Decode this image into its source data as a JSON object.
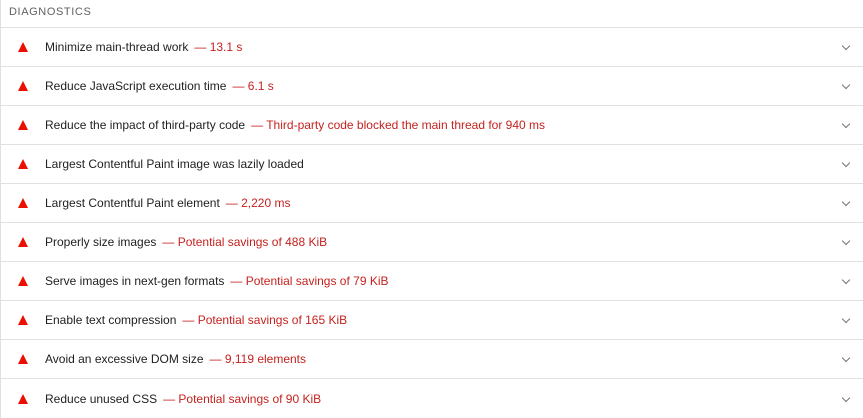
{
  "section": {
    "title": "DIAGNOSTICS"
  },
  "colors": {
    "fail": "#eb0f00",
    "display_text": "#c5221f"
  },
  "audits": [
    {
      "title": "Minimize main-thread work",
      "display": "— 13.1 s",
      "status_icon": "fail-triangle-icon"
    },
    {
      "title": "Reduce JavaScript execution time",
      "display": "— 6.1 s",
      "status_icon": "fail-triangle-icon"
    },
    {
      "title": "Reduce the impact of third-party code",
      "display": "— Third-party code blocked the main thread for 940 ms",
      "status_icon": "fail-triangle-icon"
    },
    {
      "title": "Largest Contentful Paint image was lazily loaded",
      "display": "",
      "status_icon": "fail-triangle-icon"
    },
    {
      "title": "Largest Contentful Paint element",
      "display": "— 2,220 ms",
      "status_icon": "fail-triangle-icon"
    },
    {
      "title": "Properly size images",
      "display": "— Potential savings of 488 KiB",
      "status_icon": "fail-triangle-icon"
    },
    {
      "title": "Serve images in next-gen formats",
      "display": "— Potential savings of 79 KiB",
      "status_icon": "fail-triangle-icon"
    },
    {
      "title": "Enable text compression",
      "display": "— Potential savings of 165 KiB",
      "status_icon": "fail-triangle-icon"
    },
    {
      "title": "Avoid an excessive DOM size",
      "display": "— 9,119 elements",
      "status_icon": "fail-triangle-icon"
    },
    {
      "title": "Reduce unused CSS",
      "display": "— Potential savings of 90 KiB",
      "status_icon": "fail-triangle-icon"
    }
  ]
}
